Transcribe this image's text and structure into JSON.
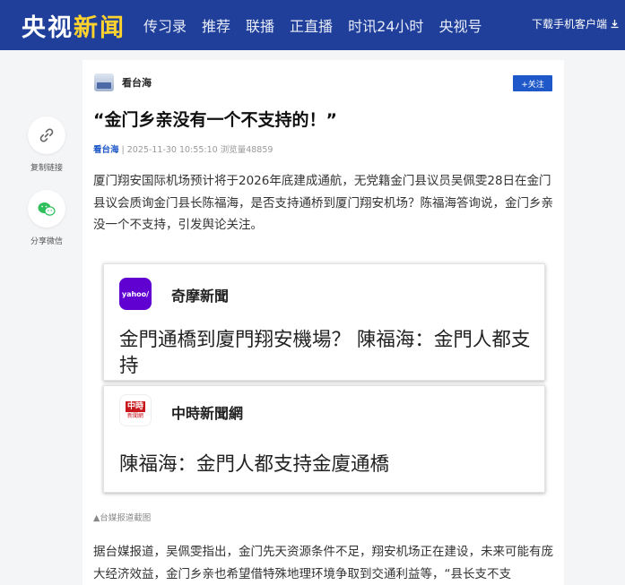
{
  "header": {
    "logo_main": "央视",
    "logo_accent": "新闻",
    "nav": [
      "传习录",
      "推荐",
      "联播",
      "正直播",
      "时讯24小时",
      "央视号"
    ],
    "download_label": "下载手机客户端"
  },
  "share": {
    "copy_link_label": "复制链接",
    "wechat_label": "分享微信"
  },
  "article": {
    "author": "看台海",
    "follow_label": "+关注",
    "title": "“金门乡亲没有一个不支持的！”",
    "meta_source": "看台海",
    "meta_divider": " | ",
    "meta_time": "2025-11-30 10:55:10",
    "meta_views": "浏览量48859",
    "para1": "厦门翔安国际机场预计将于2026年底建成通航，无党籍金门县议员吴佩雯28日在金门县议会质询金门县长陈福海，是否支持通桥到厦门翔安机场？陈福海答询说，金门乡亲没一个不支持，引发舆论关注。",
    "figure": {
      "card1_source": "奇摩新聞",
      "card1_icon_text": "yahoo/",
      "card1_headline": "金門通橋到廈門翔安機場？ 陳福海：金門人都支持",
      "card2_source": "中時新聞網",
      "card2_icon_top": "中時",
      "card2_icon_bottom": "新聞網",
      "card2_headline": "陳福海：金門人都支持金廈通橋"
    },
    "caption": "▲台媒报道截图",
    "para2": "据台媒报道，吴佩雯指出，金门先天资源条件不足，翔安机场正在建设，未来可能有庞大经济效益，金门乡亲也希望借特殊地理环境争取到交通利益等，“县长支不支"
  },
  "colors": {
    "header_bg": "#1f3f9a",
    "logo_accent": "#ffd22e",
    "link_blue": "#1f58c8",
    "yahoo_purple": "#6001d2",
    "chinatimes_red": "#c8161d",
    "wechat_green": "#2cbf5c"
  },
  "icons": {
    "download": "download-icon",
    "copy_link": "link-icon",
    "wechat": "wechat-icon"
  }
}
